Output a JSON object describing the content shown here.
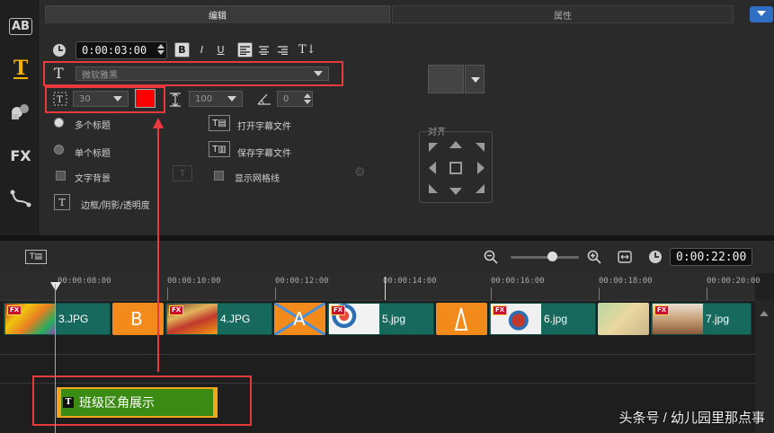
{
  "tabs": {
    "edit": "编辑",
    "attributes": "属性"
  },
  "sidebar": {
    "items": [
      {
        "name": "instant-project",
        "label": "AB"
      },
      {
        "name": "title",
        "label": "T"
      },
      {
        "name": "graphics",
        "label": ""
      },
      {
        "name": "filter",
        "label": "FX"
      },
      {
        "name": "path",
        "label": ""
      }
    ]
  },
  "edit": {
    "duration": "0:00:03:00",
    "format": {
      "bold": "B",
      "italic": "I",
      "underline": "U"
    },
    "font_name": "微软雅黑",
    "font_size": "30",
    "font_color": "#ff0000",
    "line_spacing": "100",
    "rotation": "0",
    "multi_title": "多个标题",
    "single_title": "单个标题",
    "text_background": "文字背景",
    "border_shadow": "边框/阴影/透明度",
    "open_subtitle": "打开字幕文件",
    "save_subtitle": "保存字幕文件",
    "show_grid": "显示网格线",
    "align_label": "对齐"
  },
  "timeline": {
    "total_time": "0:00:22:00",
    "ruler": [
      "00:00:08:00",
      "00:00:10:00",
      "00:00:12:00",
      "00:00:14:00",
      "00:00:16:00",
      "00:00:18:00",
      "00:00:20:00"
    ],
    "clips": [
      {
        "name": "3.JPG",
        "fx": "FX"
      },
      {
        "name": "4.JPG",
        "fx": "FX"
      },
      {
        "name": "5.jpg",
        "fx": "FX"
      },
      {
        "name": "6.jpg",
        "fx": "FX"
      },
      {
        "name": "7.jpg",
        "fx": "FX"
      }
    ],
    "transitions": [
      "B",
      "A"
    ],
    "title_clip": {
      "icon": "T",
      "text": "班级区角展示"
    }
  },
  "watermark": "头条号 / 幼儿园里那点事",
  "colors": {
    "accent": "#f3b300",
    "highlight": "#e8393d",
    "clip": "#17695e",
    "title_clip": "#3a8a13"
  }
}
